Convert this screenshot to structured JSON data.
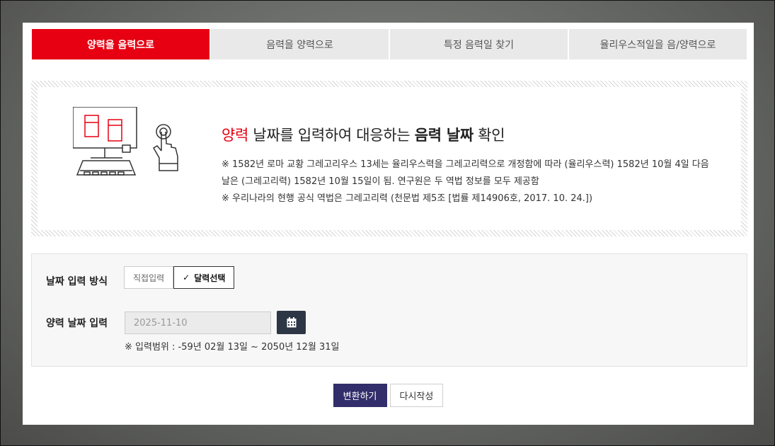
{
  "tabs": [
    {
      "label": "양력을 음력으로",
      "active": true
    },
    {
      "label": "음력을 양력으로",
      "active": false
    },
    {
      "label": "특정 음력일 찾기",
      "active": false
    },
    {
      "label": "율리우스적일을 음/양력으로",
      "active": false
    }
  ],
  "info": {
    "title_red": "양력",
    "title_mid": " 날짜를 입력하여 대응하는 ",
    "title_bold": "음력 날짜",
    "title_end": " 확인",
    "note1": "※ 1582년 로마 교황 그레고리우스 13세는 율리우스력을 그레고리력으로 개정함에 따라 (율리우스력) 1582년 10월 4일 다음 날은 (그레고리력) 1582년 10월 15일이 됨. 연구원은 두 역법 정보를 모두 제공함",
    "note2": "※ 우리나라의 현행 공식 역법은 그레고리력 (천문법 제5조 [법률 제14906호, 2017. 10. 24.])"
  },
  "form": {
    "method_label": "날짜 입력 방식",
    "method_direct": "직접입력",
    "method_calendar": "달력선택",
    "selected_method": "달력선택",
    "date_label": "양력 날짜 입력",
    "date_value": "2025-11-10",
    "range_text": "※ 입력범위 : -59년 02월 13일 ~ 2050년 12월 31일",
    "calendar_icon": "calendar-icon"
  },
  "actions": {
    "convert": "변환하기",
    "reset": "다시작성"
  },
  "colors": {
    "accent_red": "#e60012",
    "primary_button": "#322e6b",
    "calendar_button": "#2d3644"
  }
}
